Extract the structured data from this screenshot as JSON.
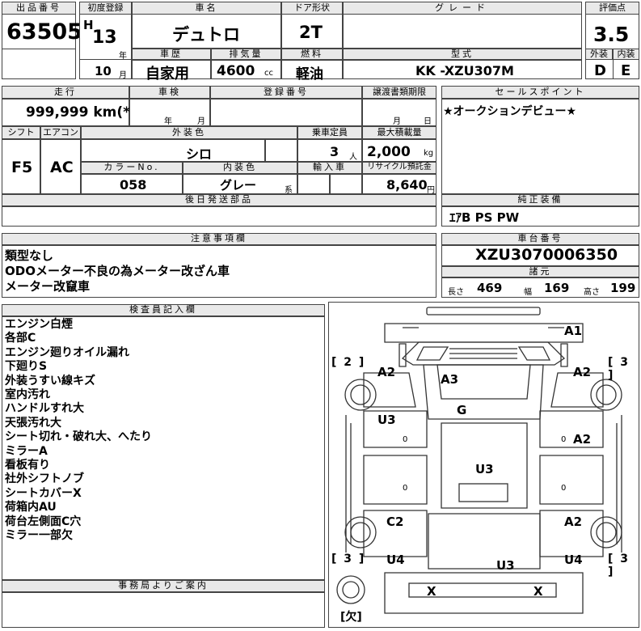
{
  "labels": {
    "lot_no": "出品番号",
    "first_reg": "初度登録",
    "car_name": "車名",
    "door": "ドア形状",
    "grade": "グレード",
    "score": "評価点",
    "year_unit": "年",
    "month_unit": "月",
    "car_history": "車歴",
    "displacement": "排気量",
    "fuel": "燃料",
    "model": "型式",
    "exterior": "外装",
    "interior": "内装",
    "mileage": "走行",
    "inspection": "車検",
    "reg_no": "登録番号",
    "transfer": "譲渡書類期限",
    "sales_point": "セールスポイント",
    "shift": "シフト",
    "aircon": "エアコン",
    "ext_color": "外装色",
    "capacity": "乗車定員",
    "max_load": "最大積載量",
    "color_no": "カラーNo.",
    "int_color": "内装色",
    "import": "輸入車",
    "recycle": "リサイクル預託金",
    "later_parts": "後日発送部品",
    "genuine": "純正装備",
    "notes": "注意事項欄",
    "chassis": "車台番号",
    "specs": "諸元",
    "length": "長さ",
    "width": "幅",
    "height": "高さ",
    "inspector": "検査員記入欄",
    "office": "事務局よりご案内",
    "cc": "cc",
    "persons": "人",
    "kg": "kg",
    "yen": "円",
    "kei": "系"
  },
  "values": {
    "lot_no": "63505",
    "era": "H",
    "year": "13",
    "month": "10",
    "car_name": "デュトロ",
    "door": "2T",
    "score": "3.5",
    "car_history": "自家用",
    "displacement": "4600",
    "fuel": "軽油",
    "model": "KK -XZU307M",
    "exterior": "D",
    "interior": "E",
    "mileage": "999,999 km(*)",
    "inspection_year": "年",
    "inspection_month": "月",
    "transfer_month": "月",
    "transfer_day": "日",
    "sales_point": "★オークションデビュー★",
    "shift": "F5",
    "aircon": "AC",
    "ext_color": "シロ",
    "capacity": "3",
    "max_load": "2,000",
    "color_no": "058",
    "int_color": "グレー",
    "recycle": "8,640",
    "genuine": "ｴｱB PS PW",
    "chassis": "XZU3070006350",
    "length": "469",
    "width": "169",
    "height": "199"
  },
  "notes": [
    "類型なし",
    "ODOメーター不良の為メーター改ざん車",
    "メーター改竄車"
  ],
  "inspector_notes": [
    "エンジン白煙",
    "各部C",
    "エンジン廻りオイル漏れ",
    "下廻りS",
    "外装うすい線キズ",
    "室内汚れ",
    "ハンドルすれ大",
    "天張汚れ大",
    "シート切れ・破れ大、へたり",
    "ミラーA",
    "看板有り",
    "社外シフトノブ",
    "シートカバーX",
    "荷箱内AU",
    "荷台左側面C穴",
    "ミラー一部欠"
  ],
  "diagram": {
    "marks": {
      "a1": "A1",
      "a2_fl": "A2",
      "a2_fr": "A2",
      "a3": "A3",
      "g": "G",
      "u3_l": "U3",
      "a2_r": "A2",
      "u3_c": "U3",
      "c2": "C2",
      "a2_rr": "A2",
      "u4_l": "U4",
      "u3_b": "U3",
      "u4_r": "U4",
      "x1": "X",
      "x2": "X"
    },
    "sides": {
      "fl": "[ 2 ]",
      "fr": "[ 3 ]",
      "rl": "[ 3 ]",
      "rr": "[ 3 ]",
      "spare": "[欠]"
    },
    "zeros": [
      "0",
      "0",
      "0",
      "0"
    ]
  }
}
